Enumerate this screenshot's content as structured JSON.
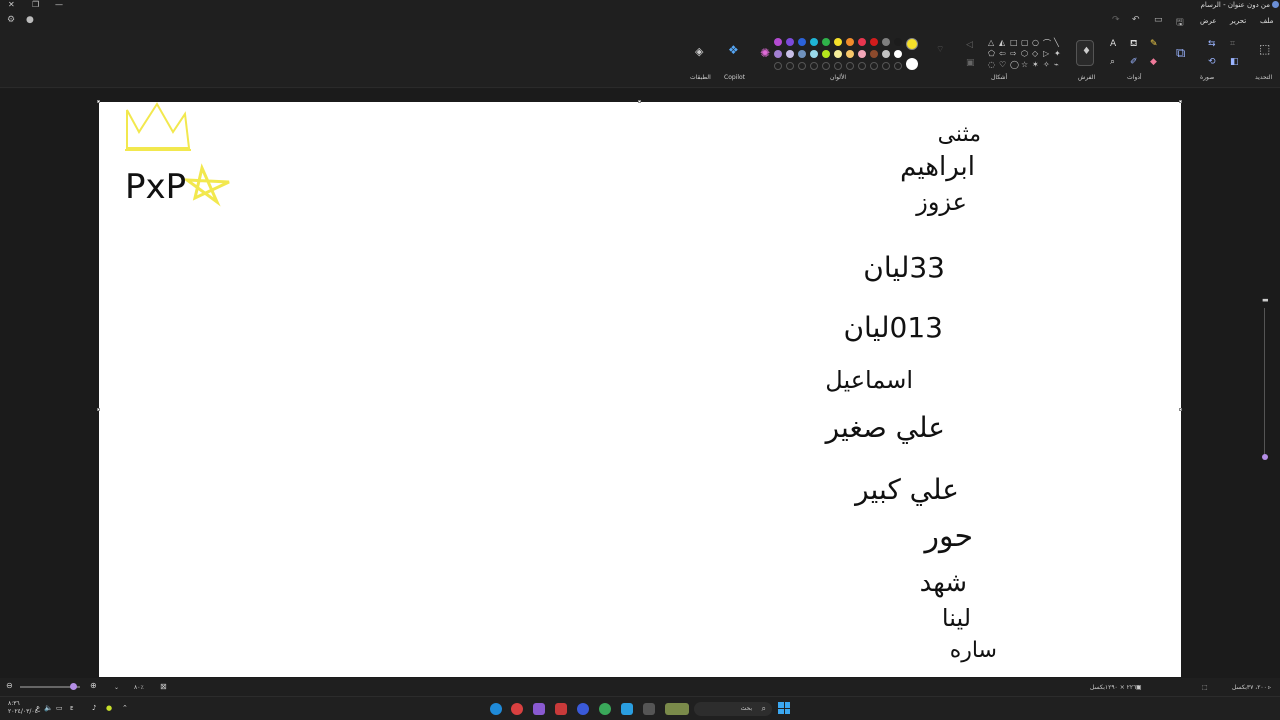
{
  "window": {
    "title": "من دون عنوان - الرسام",
    "controls": {
      "close": "✕",
      "restore": "❐",
      "minimize": "—"
    }
  },
  "menu": {
    "file": "ملف",
    "edit": "تحرير",
    "view": "عرض"
  },
  "ribbon": {
    "groups": {
      "selection": "التحديد",
      "image": "صورة",
      "tools": "أدوات",
      "brushes": "الفرش",
      "shapes": "أشكال",
      "colors": "الألوان",
      "copilot": "Copilot",
      "layers": "الطبقات"
    },
    "primary_color": "#f5e02a",
    "secondary_color": "#ffffff",
    "palette_row1": [
      "#1c1c1c",
      "#7f7f7f",
      "#d11c1c",
      "#e8364f",
      "#f08b2b",
      "#f5e02a",
      "#2fb24a",
      "#1fb5d6",
      "#2b62d9",
      "#7c4ad9",
      "#b44bd1"
    ],
    "palette_row2": [
      "#ffffff",
      "#c3c3c3",
      "#8c4a2c",
      "#f2a6b8",
      "#f7c86a",
      "#f7ee9a",
      "#b5e61d",
      "#99d9ea",
      "#7092be",
      "#c8bfe7",
      "#a17fd1"
    ]
  },
  "canvas": {
    "handwriting_names": [
      "مثنى",
      "ابراهيم",
      "عزوز",
      "33ليان",
      "013ليان",
      "اسماعيل",
      "علي صغير",
      "علي كبير",
      "حور",
      "شهد",
      "لينا",
      "ساره"
    ],
    "handwriting_left": "PxP"
  },
  "status": {
    "canvas_size": "٢٢٦٣ × ١٢٩٠بكسل",
    "position": "٢٠٠، ٣٧بكسل",
    "zoom": "٨٠٪"
  },
  "taskbar": {
    "search_label": "بحث",
    "clock_time": "٨:٣٦",
    "clock_date": "٢٠٢٤/٠٣/٠٤"
  }
}
